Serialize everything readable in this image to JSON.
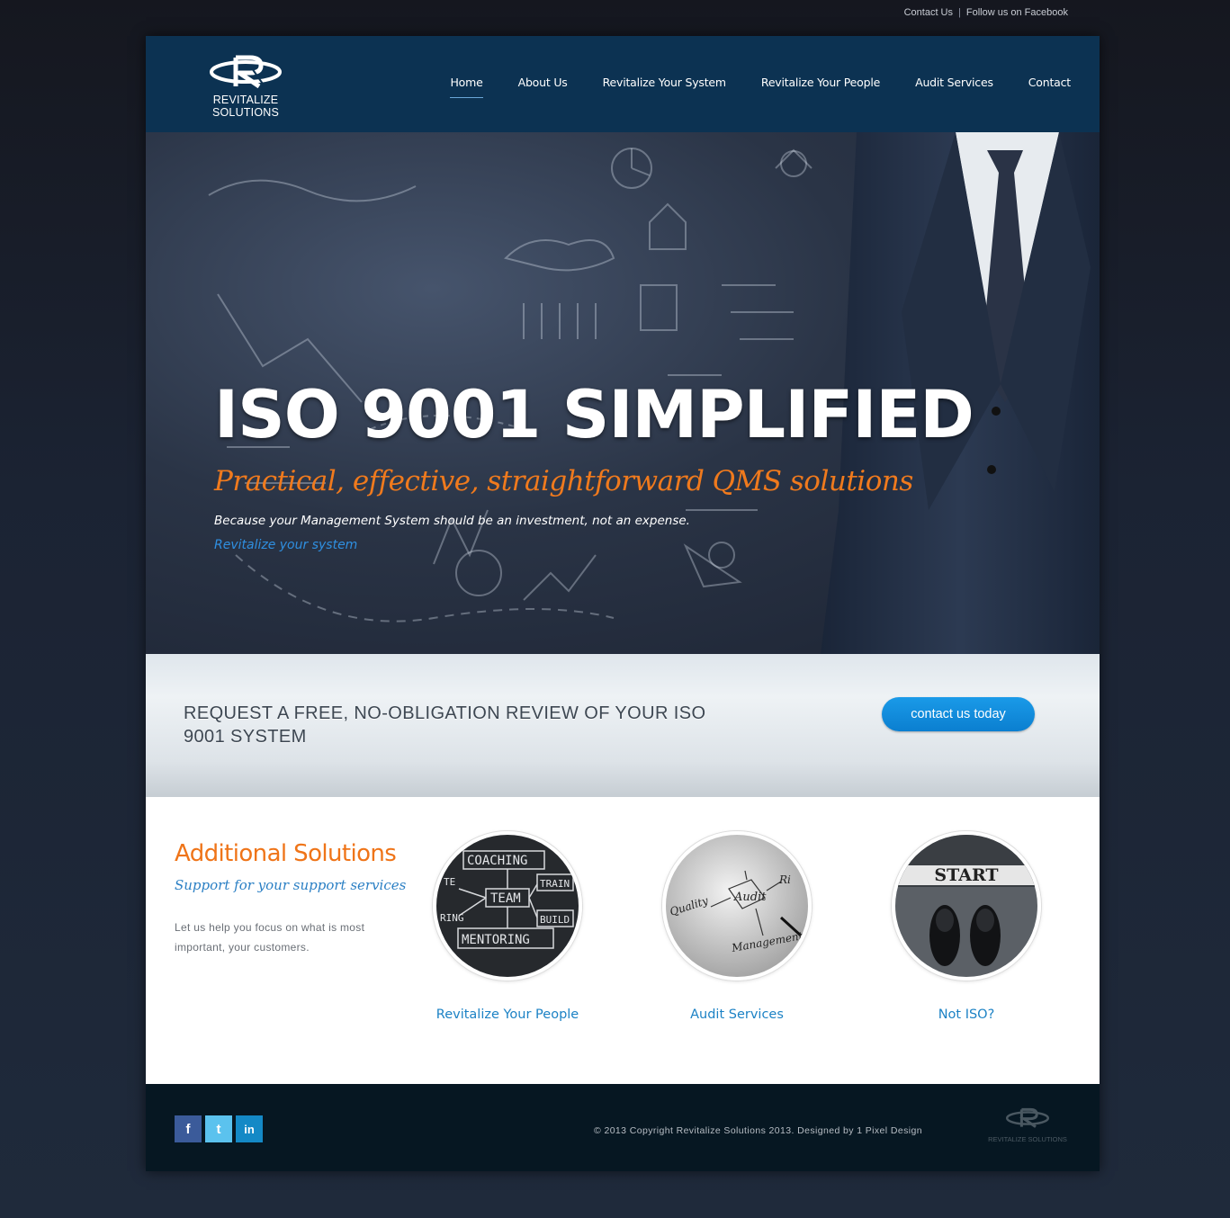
{
  "topbar": {
    "contact": "Contact Us",
    "separator": "|",
    "facebook": "Follow us on Facebook"
  },
  "brand": {
    "name": "REVITALIZE SOLUTIONS"
  },
  "nav": [
    {
      "label": "Home",
      "active": true
    },
    {
      "label": "About Us"
    },
    {
      "label": "Revitalize Your System"
    },
    {
      "label": "Revitalize Your People"
    },
    {
      "label": "Audit Services"
    },
    {
      "label": "Contact"
    }
  ],
  "hero": {
    "title": "ISO 9001 SIMPLIFIED",
    "subtitle": "Practical, effective, straightforward QMS solutions",
    "line": "Because your Management System should be an investment, not an expense.",
    "link": "Revitalize your system"
  },
  "cta": {
    "text": "REQUEST A FREE, NO-OBLIGATION REVIEW OF YOUR ISO 9001 SYSTEM",
    "button": "contact us today"
  },
  "solutions": {
    "title": "Additional Solutions",
    "tagline": "Support for your support services",
    "description": "Let us help you focus on what is most important, your customers.",
    "cards": [
      {
        "label": "Revitalize Your People",
        "words": [
          "COACHING",
          "TEAM",
          "MENTORING",
          "TRAIN",
          "BUILD",
          "TE",
          "RING"
        ]
      },
      {
        "label": "Audit Services",
        "words": [
          "Audit",
          "Quality",
          "Management",
          "Ri"
        ]
      },
      {
        "label": "Not ISO?",
        "words": [
          "START"
        ]
      }
    ]
  },
  "footer": {
    "copyright": "© 2013 Copyright Revitalize Solutions 2013. Designed by 1 Pixel Design",
    "social": {
      "facebook": "f",
      "twitter": "t",
      "linkedin": "in"
    },
    "logo_text": "REVITALIZE SOLUTIONS"
  },
  "colors": {
    "header": "#0c3252",
    "accent_orange": "#ef7418",
    "link_blue": "#1c82c5",
    "button": "#0b7fd0"
  }
}
